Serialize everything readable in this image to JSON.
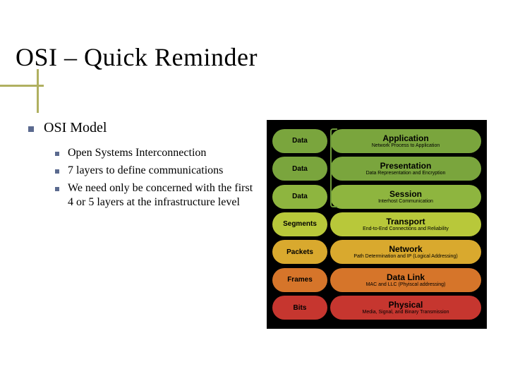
{
  "title": "OSI – Quick Reminder",
  "heading": "OSI Model",
  "bullets": [
    "Open Systems Interconnection",
    "7 layers to define communications",
    "We need only be concerned with the first 4 or 5 layers at the infrastructure level"
  ],
  "layers": [
    {
      "data": "Data",
      "name": "Application",
      "sub": "Network Process to Application",
      "color": "#7aa53d"
    },
    {
      "data": "Data",
      "name": "Presentation",
      "sub": "Data Representation and Encryption",
      "color": "#7aa53d"
    },
    {
      "data": "Data",
      "name": "Session",
      "sub": "Interhost Communication",
      "color": "#8eb53f"
    },
    {
      "data": "Segments",
      "name": "Transport",
      "sub": "End-to-End Connections and Reliability",
      "color": "#b8c83a"
    },
    {
      "data": "Packets",
      "name": "Network",
      "sub": "Path Determination and IP (Logical Addressing)",
      "color": "#d9a92e"
    },
    {
      "data": "Frames",
      "name": "Data Link",
      "sub": "MAC and LLC (Phyiscal addressing)",
      "color": "#d6752a"
    },
    {
      "data": "Bits",
      "name": "Physical",
      "sub": "Media, Signal, and Binary Transmission",
      "color": "#c6362f"
    }
  ]
}
